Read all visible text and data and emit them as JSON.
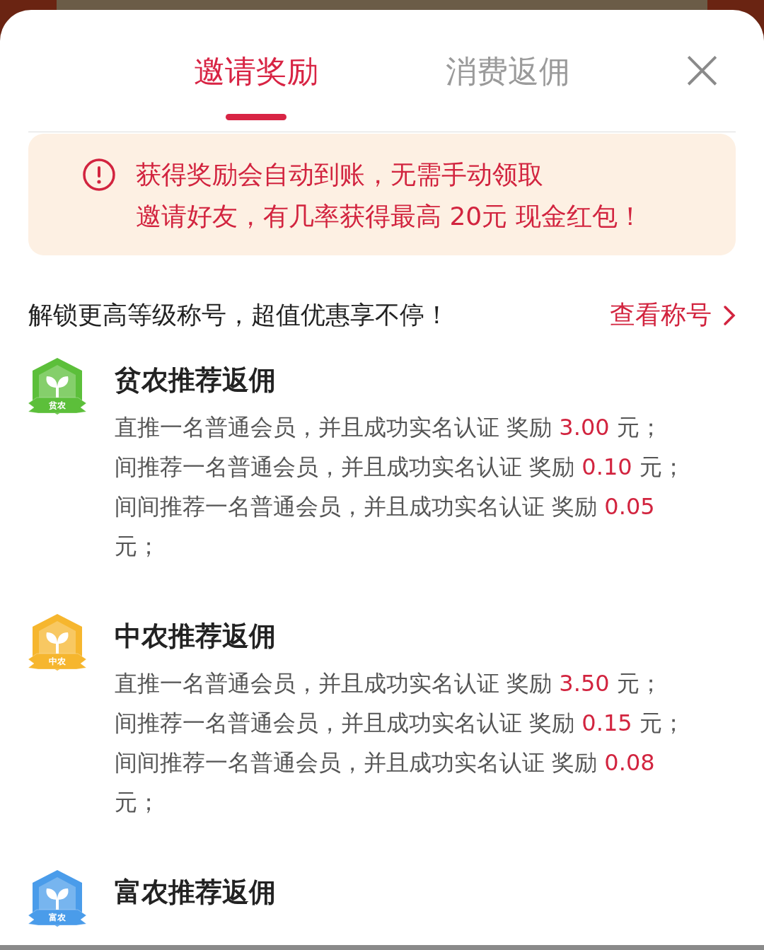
{
  "tabs": [
    {
      "label": "邀请奖励",
      "selected": true
    },
    {
      "label": "消费返佣",
      "selected": false
    }
  ],
  "close": {
    "label": "×"
  },
  "notice": {
    "lines": [
      "获得奖励会自动到账，无需手动领取",
      "邀请好友，有几率获得最高 20元 现金红包！"
    ]
  },
  "promo": {
    "text": "解锁更高等级称号，超值优惠享不停！",
    "link": "查看称号"
  },
  "sections": [
    {
      "title": "贫农推荐返佣",
      "badge": {
        "label": "贫农",
        "color": "#5cbf3a"
      },
      "rules": [
        {
          "text": "直推一名普通会员，并且成功实名认证 奖励",
          "amount": "3.00",
          "unit": "元；"
        },
        {
          "text": "间推荐一名普通会员，并且成功实名认证 奖励",
          "amount": "0.10",
          "unit": "元；"
        },
        {
          "text": "间间推荐一名普通会员，并且成功实名认证 奖励",
          "amount": "0.05",
          "unit": "元；"
        }
      ]
    },
    {
      "title": "中农推荐返佣",
      "badge": {
        "label": "中农",
        "color": "#f6b62e"
      },
      "rules": [
        {
          "text": "直推一名普通会员，并且成功实名认证 奖励",
          "amount": "3.50",
          "unit": "元；"
        },
        {
          "text": "间推荐一名普通会员，并且成功实名认证 奖励",
          "amount": "0.15",
          "unit": "元；"
        },
        {
          "text": "间间推荐一名普通会员，并且成功实名认证 奖励",
          "amount": "0.08",
          "unit": "元；"
        }
      ]
    },
    {
      "title": "富农推荐返佣",
      "badge": {
        "label": "富农",
        "color": "#4a9cea"
      }
    }
  ]
}
